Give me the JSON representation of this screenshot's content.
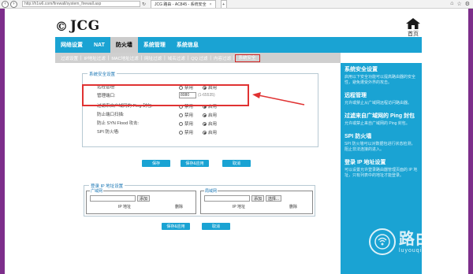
{
  "browser": {
    "url": "http://h1w6.com/firewall/system_firewall.asp",
    "tab_title": "JCG 路由 - AC845 - 系统安全",
    "tab_close": "×",
    "new_tab": "+"
  },
  "brand": {
    "logo_mark": "©",
    "logo_text": "JCG"
  },
  "home": {
    "label": "首页"
  },
  "nav": {
    "items": [
      {
        "label": "网络设置"
      },
      {
        "label": "NAT"
      },
      {
        "label": "防火墙"
      },
      {
        "label": "系统管理"
      },
      {
        "label": "系统信息"
      }
    ]
  },
  "subtabs": {
    "items": [
      {
        "label": "过滤设置"
      },
      {
        "label": "IP地址过滤"
      },
      {
        "label": "MAC地址过滤"
      },
      {
        "label": "网址过滤"
      },
      {
        "label": "域名过滤"
      },
      {
        "label": "QQ 过滤"
      },
      {
        "label": "内容过滤"
      },
      {
        "label": "系统安全"
      }
    ]
  },
  "security": {
    "legend": "系统安全设置",
    "rows": [
      {
        "label": "远程管理:",
        "opt1": "禁用",
        "opt2": "启用",
        "selected": 2
      },
      {
        "label": "管理端口:",
        "value": "8080",
        "hint": "(1-65535)"
      },
      {
        "label": "过滤来自广域网的 Ping 封包:",
        "opt1": "禁用",
        "opt2": "启用",
        "selected": 2
      },
      {
        "label": "防止端口扫描:",
        "opt1": "禁用",
        "opt2": "启用",
        "selected": 2
      },
      {
        "label": "防止 SYN Flood 攻击:",
        "opt1": "禁用",
        "opt2": "启用",
        "selected": 2
      },
      {
        "label": "SPI 防火墙:",
        "opt1": "禁用",
        "opt2": "启用",
        "selected": 2
      }
    ],
    "buttons": {
      "save": "保存",
      "save_apply": "保存&应用",
      "cancel": "取消"
    }
  },
  "login_ip": {
    "legend": "登录 IP 地址设置",
    "lan": {
      "title": "广域网",
      "add": "添加",
      "col_ip": "IP 地址",
      "col_del": "删除"
    },
    "wan": {
      "title": "局域网",
      "add": "添加",
      "select": "选择...",
      "col_ip": "IP 地址",
      "col_del": "删除"
    },
    "buttons": {
      "save_apply": "保存&应用",
      "cancel": "取消"
    }
  },
  "info": {
    "blocks": [
      {
        "title": "系统安全设置",
        "desc": "启用以下安全功能可以提高路由器的安全性，避免遭受外界的攻击。"
      },
      {
        "title": "远程管理",
        "desc": "允许或禁止从广域网远程访问路由器。"
      },
      {
        "title": "过滤来自广域网的 Ping 封包",
        "desc": "允许或禁止来自广域网的 Ping 封包。"
      },
      {
        "title": "SPI 防火墙",
        "desc": "SPI 防火墙可以对数据包进行状态检测，阻止非法连接的进入。"
      },
      {
        "title": "登录 IP 地址设置",
        "desc": "可以设置允许登录路由器管理页面的 IP 地址，只有列表中的地址才能登录。"
      }
    ]
  },
  "watermark": {
    "main": "路由器",
    "sub": "luyouqi.com"
  },
  "colors": {
    "accent": "#1aa3d3",
    "highlight": "#e03232",
    "side": "#7d2e8b"
  }
}
